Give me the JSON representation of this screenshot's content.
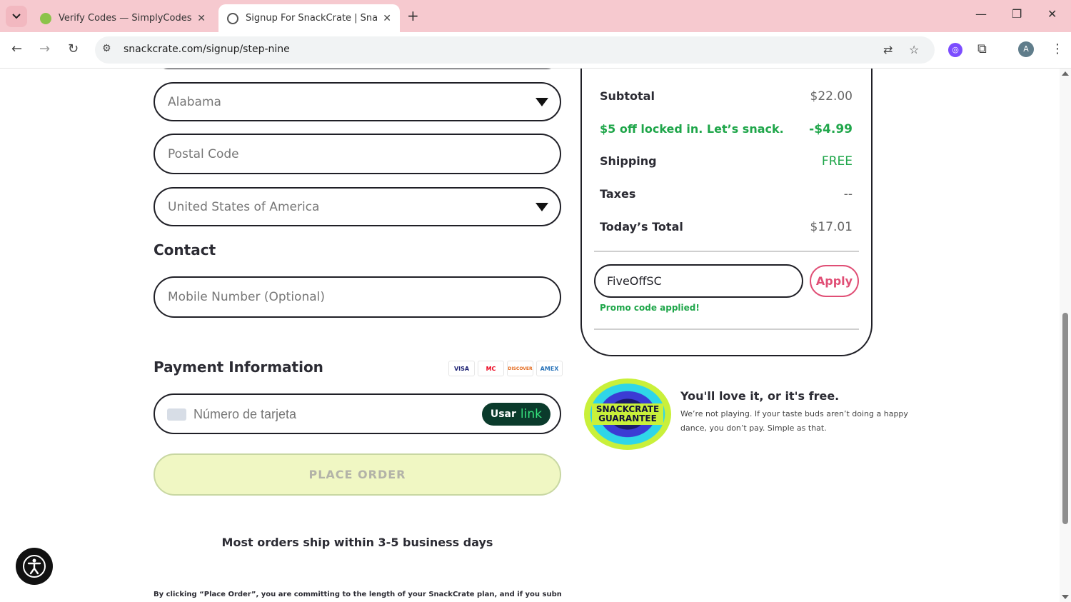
{
  "browser": {
    "tabs": [
      {
        "title": "Verify Codes — SimplyCodes",
        "icon": "simplycodes-favicon"
      },
      {
        "title": "Signup For SnackCrate | SnackC",
        "icon": "globe-icon"
      }
    ],
    "new_tab": "+",
    "url": "snackcrate.com/signup/step-nine",
    "profile_initial": "A"
  },
  "form": {
    "state_select": "Alabama",
    "postal_code_placeholder": "Postal Code",
    "country_select": "United States of America",
    "contact_heading": "Contact",
    "mobile_placeholder": "Mobile Number (Optional)",
    "payment_heading": "Payment Information",
    "card_brands": [
      "VISA",
      "MC",
      "DISCOVER",
      "AMEX"
    ],
    "card_number_placeholder": "Número de tarjeta",
    "link_button": {
      "usar": "Usar",
      "link": "link"
    },
    "place_order": "PLACE ORDER",
    "ship_note": "Most orders ship within 3-5 business days",
    "legal": "By clicking “Place Order”, you are committing to the length of your SnackCrate plan, and if you submit"
  },
  "summary": {
    "subtotal_label": "Subtotal",
    "subtotal_value": "$22.00",
    "promo_label": "$5 off locked in. Let’s snack.",
    "promo_value": "-$4.99",
    "shipping_label": "Shipping",
    "shipping_value": "FREE",
    "taxes_label": "Taxes",
    "taxes_value": "--",
    "total_label": "Today’s Total",
    "total_value": "$17.01",
    "promo_code": "FiveOffSC",
    "apply_label": "Apply",
    "promo_status": "Promo code applied!"
  },
  "guarantee": {
    "badge_line1": "SNACKCRATE",
    "badge_line2": "GUARANTEE",
    "title": "You'll love it, or it's free.",
    "body": "We’re not playing. If your taste buds aren’t doing a happy dance, you don’t pay. Simple as that."
  },
  "colors": {
    "accent_green": "#1fa64a",
    "apply_pink": "#e04e75",
    "place_order_bg": "#f0f7c3",
    "tabbar": "#f6c9cf"
  }
}
